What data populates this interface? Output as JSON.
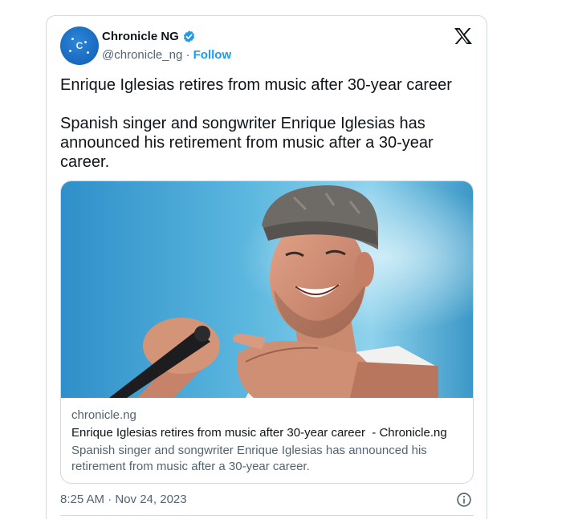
{
  "account": {
    "name": "Chronicle NG",
    "handle": "@chronicle_ng",
    "separator": "·",
    "follow_label": "Follow",
    "avatar_letter": "C"
  },
  "tweet": {
    "headline": "Enrique Iglesias retires from music after 30-year career",
    "body": "Spanish singer and songwriter Enrique Iglesias has announced his retirement from music after a 30-year career."
  },
  "card": {
    "domain": "chronicle.ng",
    "title": "Enrique Iglesias retires from music after 30-year career  - Chronicle.ng",
    "description": "Spanish singer and songwriter Enrique Iglesias has announced his retirement from music after a 30-year career."
  },
  "footer": {
    "timestamp": "8:25 AM · Nov 24, 2023"
  },
  "icons": {
    "verified": "verified-badge-icon",
    "platform": "x-logo-icon",
    "info": "info-icon"
  },
  "colors": {
    "accent": "#1d9bf0",
    "secondary_text": "#536471",
    "border": "#cfd9de",
    "avatar": "#1a6dc2"
  }
}
